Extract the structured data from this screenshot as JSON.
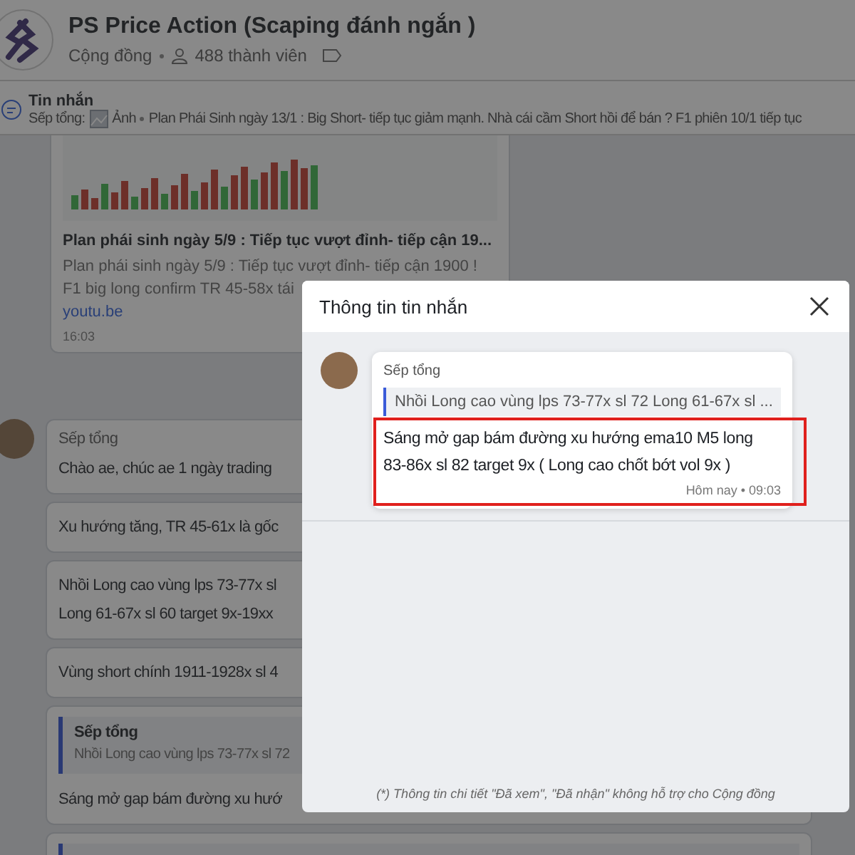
{
  "group": {
    "name": "PS Price Action (Scaping đánh ngắn )",
    "type": "Cộng đồng",
    "members": "488 thành viên"
  },
  "pinned": {
    "label": "Tin nhắn",
    "sender": "Sếp tổng:",
    "kind_label": "Ảnh",
    "text": "Plan Phái Sinh ngày 13/1 : Big Short- tiếp tục giảm mạnh. Nhà cái cầm Short hồi để bán ?  F1 phiên 10/1 tiếp tục"
  },
  "link_card": {
    "title": "Plan phái sinh ngày 5/9 : Tiếp tục vượt đỉnh- tiếp cận 19...",
    "lines": [
      "Plan phái sinh ngày 5/9 : Tiếp tục vượt đỉnh- tiếp cận 1900 !",
      "F1 big long confirm TR 45-58x tái"
    ],
    "domain": "youtu.be",
    "time": "16:03"
  },
  "messages": [
    {
      "sender": "Sếp tổng",
      "lines": [
        "Chào ae, chúc ae 1 ngày trading"
      ]
    },
    {
      "lines": [
        "Xu hướng tăng, TR 45-61x là gốc"
      ]
    },
    {
      "lines": [
        "Nhồi Long cao vùng lps 73-77x sl",
        "Long 61-67x sl 60 target 9x-19xx"
      ]
    },
    {
      "lines": [
        "Vùng short chính 1911-1928x sl 4"
      ]
    },
    {
      "kind": "reply",
      "quote": {
        "sender": "Sếp tổng",
        "text": "Nhồi Long cao vùng lps 73-77x sl 72"
      },
      "lines": [
        "Sáng mở gap bám đường xu hướ"
      ]
    },
    {
      "kind": "reply"
    }
  ],
  "dialog": {
    "title": "Thông tin tin nhắn",
    "message": {
      "sender": "Sếp tổng",
      "quote": "Nhồi Long cao vùng lps 73-77x sl 72 Long 61-67x sl ...",
      "text": "Sáng mở gap bám đường xu hướng ema10 M5 long 83-86x sl 82 target 9x ( Long cao chốt bớt vol 9x )",
      "time": "Hôm nay • 09:03",
      "highlighted": true
    },
    "footnote": "(*) Thông tin chi tiết \"Đã xem\", \"Đã nhận\" không hỗ trợ cho Cộng đồng"
  }
}
